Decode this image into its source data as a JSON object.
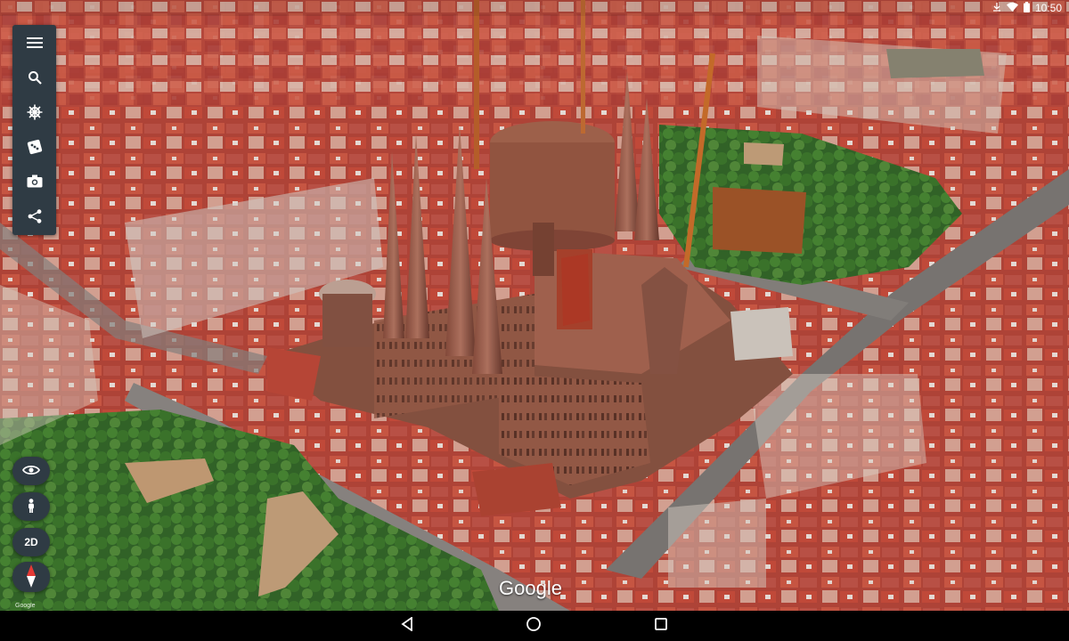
{
  "status_bar": {
    "time": "10:50",
    "icons": [
      "download-icon",
      "wifi-icon",
      "battery-icon"
    ]
  },
  "toolbar": {
    "items": [
      {
        "name": "menu",
        "icon": "menu-icon"
      },
      {
        "name": "search",
        "icon": "search-icon"
      },
      {
        "name": "voyager",
        "icon": "ships-wheel-icon"
      },
      {
        "name": "feeling-lucky",
        "icon": "dice-icon"
      },
      {
        "name": "postcard",
        "icon": "camera-icon"
      },
      {
        "name": "share",
        "icon": "share-icon"
      }
    ]
  },
  "view_controls": {
    "eye_icon": "eye-icon",
    "pegman_icon": "pegman-icon",
    "mode_2d_label": "2D",
    "compass_icon": "compass-icon"
  },
  "watermark": {
    "logo_text": "Google",
    "small_label": "Google"
  },
  "nav_bar": {
    "icons": [
      "back-icon",
      "home-icon",
      "recent-apps-icon"
    ]
  },
  "colors": {
    "toolbar_bg": "#2f3b44",
    "roof_red": "#c9473a",
    "stone": "#a56b55",
    "park_green": "#3f7a2c"
  }
}
